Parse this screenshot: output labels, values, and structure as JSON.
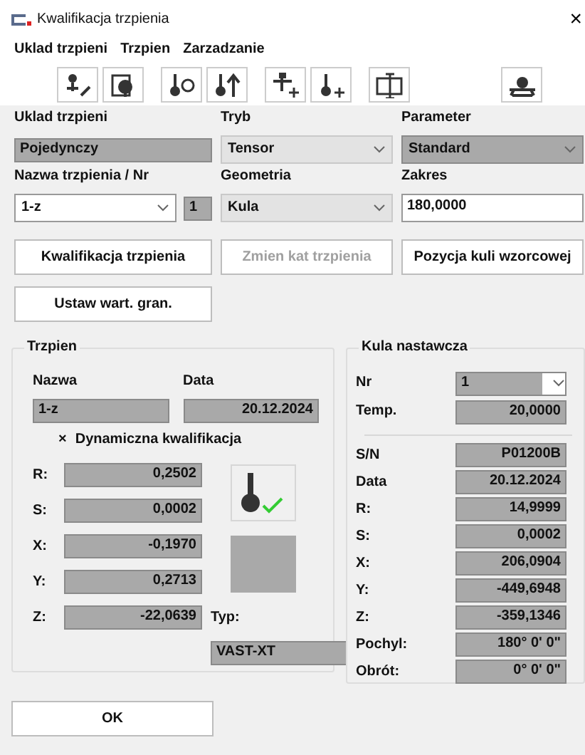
{
  "window": {
    "title": "Kwalifikacja trzpienia",
    "close": "×"
  },
  "menu": [
    "Uklad trzpieni",
    "Trzpien",
    "Zarzadzanie"
  ],
  "settings": [
    {
      "label": "Uklad trzpieni",
      "kind": "readonly",
      "value": "Pojedynczy"
    },
    {
      "label": "Tryb",
      "kind": "combo",
      "value": "Tensor"
    },
    {
      "label": "Parameter",
      "kind": "readonly-combo",
      "value": "Standard"
    },
    {
      "label": "Nazwa trzpienia / Nr",
      "kind": "white-combo",
      "value": "1-z",
      "number": "1"
    },
    {
      "label": "Geometria",
      "kind": "combo",
      "value": "Kula"
    },
    {
      "label": "Zakres",
      "kind": "input",
      "value": "180,0000"
    }
  ],
  "buttons": [
    {
      "label": "Kwalifikacja trzpienia",
      "disabled": false
    },
    {
      "label": "Zmien kat trzpienia",
      "disabled": true
    },
    {
      "label": "Pozycja kuli wzorcowej",
      "disabled": false
    },
    {
      "label": "Ustaw wart. gran.",
      "disabled": false
    }
  ],
  "stylus": {
    "title": "Trzpien",
    "name_label": "Nazwa",
    "name": "1-z",
    "date_label": "Data",
    "date": "20.12.2024",
    "dynamic_mark": "×",
    "dynamic_label": "Dynamiczna kwalifikacja",
    "qualified": true,
    "values": [
      {
        "label": "R:",
        "value": "0,2502"
      },
      {
        "label": "S:",
        "value": "0,0002"
      },
      {
        "label": "X:",
        "value": "-0,1970"
      },
      {
        "label": "Y:",
        "value": "0,2713"
      },
      {
        "label": "Z:",
        "value": "-22,0639"
      }
    ],
    "type_label": "Typ:",
    "type": "VAST-XT"
  },
  "sphere": {
    "title": "Kula nastawcza",
    "nr_label": "Nr",
    "nr": "1",
    "temp_label": "Temp.",
    "temp": "20,0000",
    "rows": [
      {
        "label": "S/N",
        "value": "P01200B"
      },
      {
        "label": "Data",
        "value": "20.12.2024"
      },
      {
        "label": "R:",
        "value": "14,9999"
      },
      {
        "label": "S:",
        "value": "0,0002"
      },
      {
        "label": "X:",
        "value": "206,0904"
      },
      {
        "label": "Y:",
        "value": "-449,6948"
      },
      {
        "label": "Z:",
        "value": "-359,1346"
      },
      {
        "label": "Pochyl:",
        "value": "180° 0' 0\""
      },
      {
        "label": "Obrót:",
        "value": "0° 0' 0\""
      }
    ]
  },
  "ok": "OK"
}
